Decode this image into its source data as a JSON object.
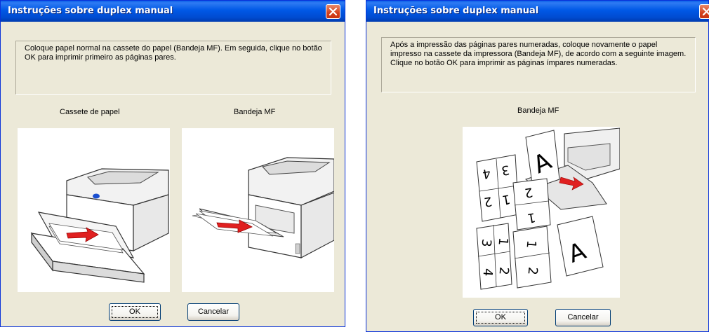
{
  "dialog_left": {
    "title": "Instruções sobre duplex manual",
    "message": "Coloque papel normal na cassete do papel (Bandeja MF). Em seguida, clique no botão OK para imprimir primeiro as páginas pares.",
    "image_label_1": "Cassete de papel",
    "image_label_2": "Bandeja MF",
    "ok_label": "OK",
    "cancel_label": "Cancelar"
  },
  "dialog_right": {
    "title": "Instruções sobre duplex manual",
    "message": "Após a impressão das páginas pares numeradas, coloque novamente o papel impresso na cassete da impressora (Bandeja MF), de acordo com a seguinte imagem. Clique no botão OK para imprimir as páginas ímpares numeradas.",
    "image_label": "Bandeja MF",
    "ok_label": "OK",
    "cancel_label": "Cancelar"
  },
  "colors": {
    "titlebar": "#0058e6",
    "dialog_bg": "#ece9d8",
    "close_button": "#d4401c",
    "arrow": "#e02020"
  },
  "icons": [
    "close-icon",
    "printer-tray-illustration"
  ]
}
